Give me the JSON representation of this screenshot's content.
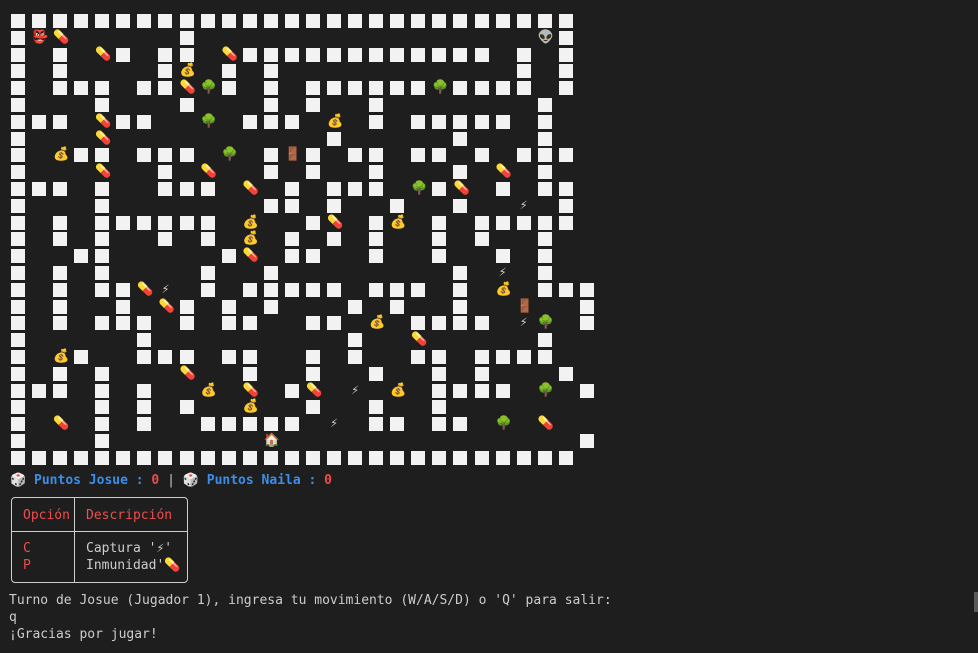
{
  "maze": {
    "rows": [
      "WWWWWWWWWWWWWWWWWWWWWWWWWWW",
      "WDP.....W................AW",
      "W.W.PW.WW.PWWWWWWWWWWWW.W.W",
      "W.W....W$.W.W...........W.W",
      "W.WWW.WWPTW.W.WWWWWWTWWWW.W",
      "W...W...W...W.W..W.......W.",
      "WWW.PWW..T.WWW.$.W.WWWWW.W.",
      "W...P..........W.....W...W.",
      "W.$WW.WWW.T.WEW.WW.WW.W.WWW",
      "W...P..W.P..W.W..W...W.P.W.",
      "WWW.W..WWW.P.W.WWW.TWP.W.WW",
      "W...W.......WW.W..W..W..F.W",
      "W.W.WWWWWW.$..WP.W$.W.WWWWW",
      "W.W.W..W.W.$.W.W.W..W.W..W.",
      "W..WW.....WP.WW..W..W..W.W.",
      "W.W.W....W..W........W.F.W.",
      "W.W.WWPF.W.WWWWW.WWW.W.$.WWW",
      "W.W..W.PW.W.W...W.W..W..E..W",
      "W.W.WWW.W.WW..WW.$.WWWW.FT.W",
      "W.....W.........W..P.....W.",
      "W.$W..WWW.WW..W.W..WW.WWWW.",
      "W.W.W...P..W..W..W..W.W...W",
      "WWW.W.W..$.P.WP.F.$.WWWW.T.W",
      "W...W.W.W..$..W..W..W......",
      "W.P.W.W..WWWWW.F.WW.WW.T.P.",
      "W...W.......H..............W",
      "WWWWWWWWWWWWWWWWWWWWWWWWWWW"
    ],
    "glyphs": {
      "D": "👺",
      "A": "👽",
      "P": "💊",
      "$": "💰",
      "T": "🌳",
      "F": "⚡",
      "E": "🚪",
      "H": "🏠"
    },
    "colors": {
      "wall": "#f2f2f2",
      "floor": "#1e1e1e"
    }
  },
  "score": {
    "dice_icon": "🎲",
    "p1_label": "Puntos Josue : ",
    "p1_value": "0",
    "separator": " | ",
    "p2_label": "Puntos Naila : ",
    "p2_value": "0"
  },
  "legend": {
    "header_option": "Opción",
    "header_description": "Descripción",
    "rows": [
      {
        "key": "C",
        "desc": "Captura '⚡'"
      },
      {
        "key": "P",
        "desc": "Inmunidad'💊"
      }
    ]
  },
  "terminal": {
    "prompt": "Turno de Josue (Jugador 1), ingresa tu movimiento (W/A/S/D) o 'Q' para salir:",
    "input": "q",
    "goodbye": "¡Gracias por jugar!"
  },
  "colors": {
    "background": "#1e1e1e",
    "text": "#cccccc",
    "blue": "#3b8eea",
    "red": "#f14c4c"
  }
}
